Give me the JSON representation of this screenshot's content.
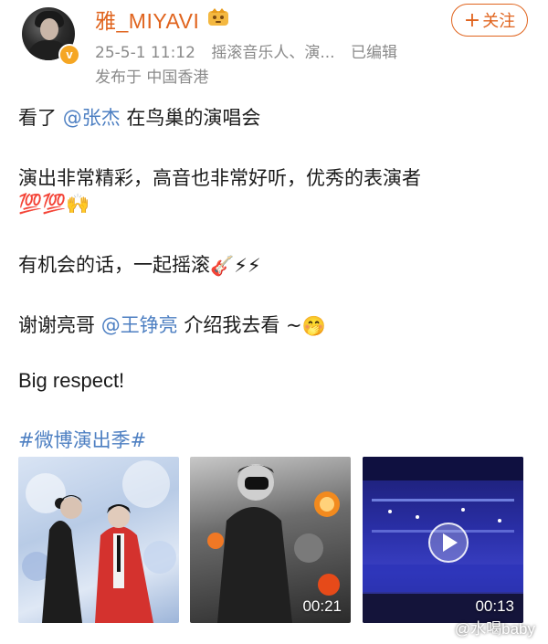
{
  "post": {
    "username": "雅_MIYAVI",
    "verified_badge_icon": "v-badge-icon",
    "crown_icon": "crown-icon",
    "meta": {
      "time": "25-5-1 11:12",
      "source": "摇滚音乐人、演...",
      "edited": "已编辑",
      "location": "发布于 中国香港"
    },
    "follow_label": "关注",
    "content": {
      "line1_pre": "看了 ",
      "line1_mention": "@张杰",
      "line1_post": " 在鸟巢的演唱会",
      "line2": "演出非常精彩，高音也非常好听，优秀的表演者",
      "line3_emojis": [
        "💯",
        "💯",
        "🙌"
      ],
      "line4": "有机会的话，一起摇滚",
      "line4_emojis": [
        "🎸",
        "⚡",
        "⚡"
      ],
      "line5_pre": "谢谢亮哥 ",
      "line5_mention": "@王铮亮",
      "line5_post": " 介绍我去看 ~",
      "line5_emoji": "🤭",
      "line6": "Big respect!",
      "hashtag": "#微博演出季#"
    },
    "media": [
      {
        "type": "image"
      },
      {
        "type": "video",
        "duration": "00:21"
      },
      {
        "type": "video",
        "duration": "00:13"
      }
    ]
  },
  "watermark": "@水喝baby",
  "colors": {
    "username": "#e0641e",
    "link": "#4d7fc2",
    "meta": "#8a8a8a"
  }
}
